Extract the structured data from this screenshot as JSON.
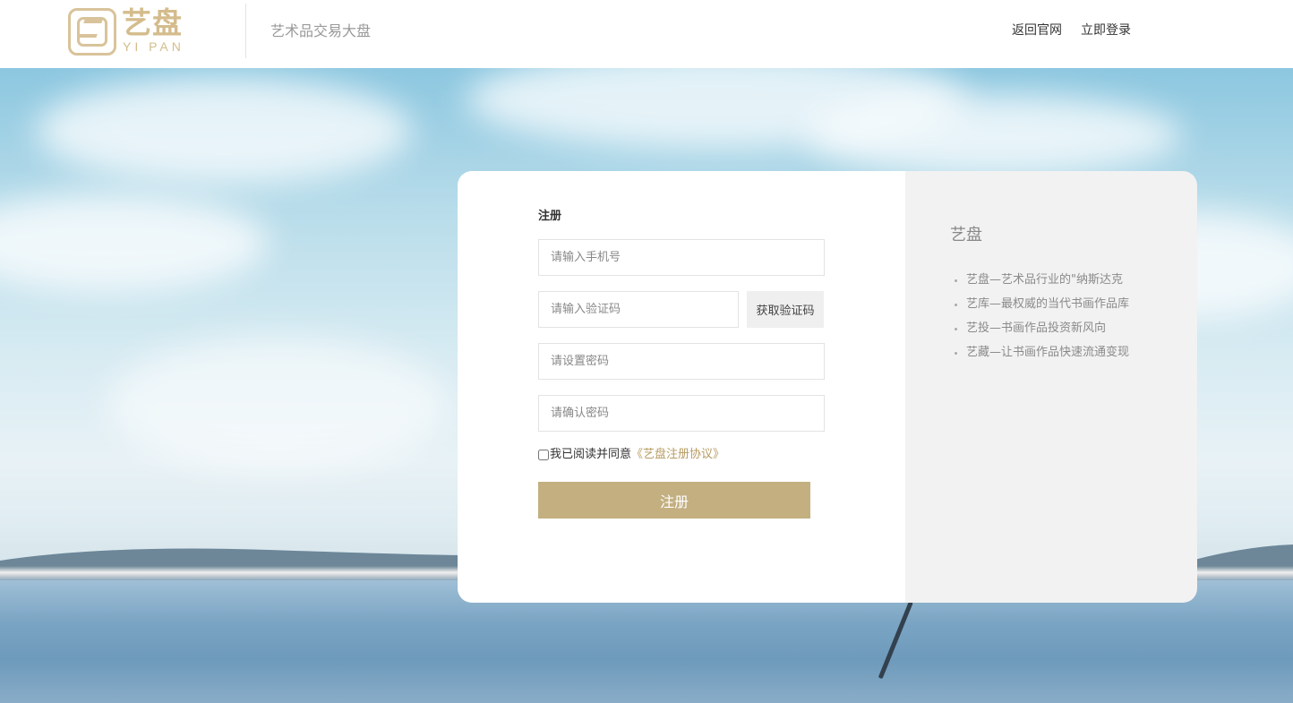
{
  "header": {
    "logo_cn": "艺盘",
    "logo_en": "YI PAN",
    "subtitle": "艺术品交易大盘",
    "nav": [
      {
        "label": "返回官网"
      },
      {
        "label": "立即登录"
      }
    ]
  },
  "register": {
    "title": "注册",
    "phone_placeholder": "请输入手机号",
    "code_placeholder": "请输入验证码",
    "get_code_label": "获取验证码",
    "password_placeholder": "请设置密码",
    "confirm_placeholder": "请确认密码",
    "agree_text": "我已阅读并同意",
    "agreement_link": "《艺盘注册协议》",
    "agreement_checked": false,
    "submit_label": "注册"
  },
  "info": {
    "title": "艺盘",
    "items": [
      "艺盘—艺术品行业的\"纳斯达克",
      "艺库—最权威的当代书画作品库",
      "艺投—书画作品投资新风向",
      "艺藏—让书画作品快速流通变现"
    ]
  },
  "colors": {
    "accent": "#c3af80",
    "logo": "#d4bc8c",
    "link": "#b79c62",
    "info_panel": "#f2f2f2"
  }
}
